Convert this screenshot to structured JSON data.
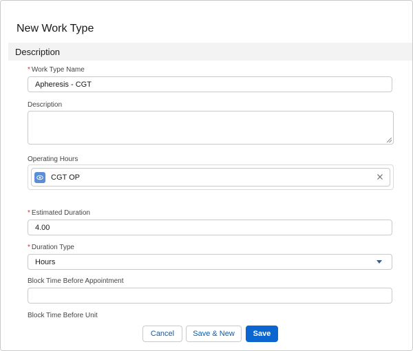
{
  "dialog": {
    "title": "New Work Type"
  },
  "section": {
    "title": "Description"
  },
  "fields": {
    "work_type_name": {
      "label": "Work Type Name",
      "required_mark": "*",
      "value": "Apheresis - CGT"
    },
    "description": {
      "label": "Description",
      "value": ""
    },
    "operating_hours": {
      "label": "Operating Hours",
      "value": "CGT OP",
      "icon": "eye-icon",
      "clear_icon": "close-icon"
    },
    "estimated_duration": {
      "label": "Estimated Duration",
      "required_mark": "*",
      "value": "4.00"
    },
    "duration_type": {
      "label": "Duration Type",
      "required_mark": "*",
      "value": "Hours"
    },
    "block_time_before_appointment": {
      "label": "Block Time Before Appointment",
      "value": ""
    },
    "block_time_before_unit": {
      "label": "Block Time Before Unit"
    }
  },
  "footer": {
    "cancel_label": "Cancel",
    "save_new_label": "Save & New",
    "save_label": "Save"
  },
  "colors": {
    "brand": "#0b66d0",
    "required": "#c23934",
    "section_bg": "#f3f3f3",
    "lookup_icon": "#5b8ed6"
  }
}
